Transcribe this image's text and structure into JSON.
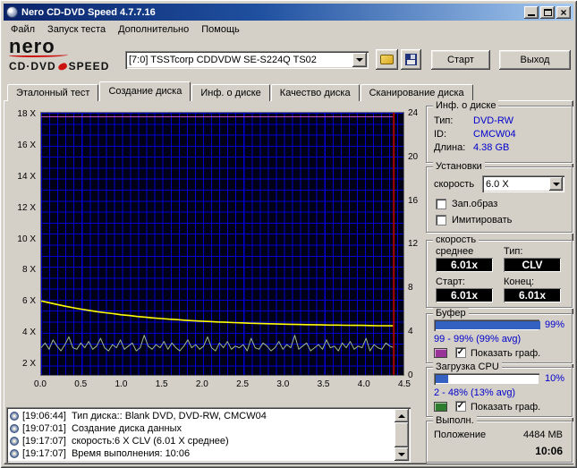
{
  "window": {
    "title": "Nero CD-DVD Speed 4.7.7.16"
  },
  "menu": {
    "items": [
      "Файл",
      "Запуск теста",
      "Дополнительно",
      "Помощь"
    ]
  },
  "logo": {
    "brand": "nero",
    "product_left": "CD·DVD",
    "product_right": "SPEED"
  },
  "toolbar": {
    "drive_selector": "[7:0]   TSSTcorp CDDVDW SE-S224Q TS02",
    "start_button": "Старт",
    "exit_button": "Выход"
  },
  "tabs": [
    {
      "label": "Эталонный тест",
      "active": false
    },
    {
      "label": "Создание диска",
      "active": true
    },
    {
      "label": "Инф. о диске",
      "active": false
    },
    {
      "label": "Качество диска",
      "active": false
    },
    {
      "label": "Сканирование диска",
      "active": false
    }
  ],
  "chart": {
    "type": "line",
    "left_axis_labels": [
      "18 X",
      "16 X",
      "14 X",
      "12 X",
      "10 X",
      "8 X",
      "6 X",
      "4 X",
      "2 X"
    ],
    "right_axis_labels": [
      "24",
      "20",
      "16",
      "12",
      "8",
      "4",
      "0"
    ],
    "x_axis_labels": [
      "0.0",
      "0.5",
      "1.0",
      "1.5",
      "2.0",
      "2.5",
      "3.0",
      "3.5",
      "4.0",
      "4.5"
    ],
    "x_range": [
      0,
      4.5
    ],
    "capacity_line_x": 4.38,
    "grid_color": "#0000d2",
    "background": "#000016",
    "series": [
      {
        "name": "write-speed",
        "color": "#ffff00",
        "width": 1.6,
        "x0": 0,
        "x_end": 4.38,
        "values": [
          6.0,
          5.88,
          5.77,
          5.66,
          5.56,
          5.47,
          5.39,
          5.31,
          5.24,
          5.18,
          5.11,
          5.06,
          5.0,
          4.96,
          4.91,
          4.87,
          4.83,
          4.8,
          4.76,
          4.73,
          4.7,
          4.68,
          4.65,
          4.63,
          4.61,
          4.59,
          4.57,
          4.56,
          4.54,
          4.53,
          4.51,
          4.5,
          4.49,
          4.48,
          4.47,
          4.46,
          4.45,
          4.45,
          4.44,
          4.43,
          4.43,
          4.42,
          4.41,
          4.41,
          4.4
        ]
      },
      {
        "name": "cpu-usage",
        "color": "#9dbb8d",
        "width": 1,
        "x0": 0,
        "x_end": 4.38,
        "values": [
          3.0,
          3.3,
          2.9,
          3.5,
          3.1,
          2.8,
          3.2,
          3.7,
          3.0,
          2.9,
          3.3,
          3.0,
          3.4,
          2.9,
          3.1,
          3.6,
          3.0,
          2.8,
          3.2,
          3.0,
          3.5,
          2.9,
          3.1,
          3.3,
          2.8,
          3.0,
          3.8,
          3.1,
          2.9,
          3.2,
          3.0,
          3.4,
          2.9,
          3.3,
          3.0,
          2.8,
          3.1,
          3.5,
          3.0,
          3.2,
          2.9,
          3.1,
          3.7,
          3.0,
          2.8,
          3.3,
          3.0,
          3.4,
          2.9,
          3.1,
          3.0,
          3.2,
          2.8,
          3.6,
          3.0,
          2.9,
          3.3,
          3.1,
          2.8,
          3.0,
          3.4,
          2.9,
          3.2,
          3.0,
          3.8,
          2.9,
          3.1,
          3.3,
          2.8,
          3.0,
          3.2,
          2.9,
          3.5,
          3.0,
          3.1,
          2.8,
          3.3,
          3.0,
          3.4,
          2.9,
          3.1,
          3.0,
          3.6,
          2.8,
          3.2,
          3.0,
          2.9,
          3.3,
          3.1,
          3.0
        ]
      },
      {
        "name": "buffer-level",
        "color": "#c050c0",
        "width": 1,
        "x0": 0,
        "x_end": 4.38,
        "values": [
          17.8,
          17.8
        ]
      }
    ]
  },
  "panels": {
    "disc_info": {
      "title": "Инф. о диске",
      "rows": [
        {
          "label": "Тип:",
          "value": "DVD-RW"
        },
        {
          "label": "ID:",
          "value": "CMCW04"
        },
        {
          "label": "Длина:",
          "value": "4.38 GB"
        }
      ]
    },
    "settings": {
      "title": "Установки",
      "speed_label": "скорость",
      "speed_value": "6.0 X",
      "checkboxes": [
        {
          "label": "Зап.образ",
          "checked": false
        },
        {
          "label": "Имитировать",
          "checked": false
        }
      ]
    },
    "speed": {
      "title": "скорость",
      "average_label": "среднее",
      "average_value": "6.01x",
      "type_label": "Тип:",
      "type_value": "CLV",
      "start_label": "Старт:",
      "start_value": "6.01x",
      "end_label": "Конец:",
      "end_value": "6.01x"
    },
    "buffer": {
      "title": "Буфер",
      "percent_label": "99%",
      "fill_percent": 99,
      "range_text": "99 - 99% (99% avg)",
      "swatch_color": "#993399",
      "show_graph": {
        "label": "Показать граф.",
        "checked": true
      }
    },
    "cpu": {
      "title": "Загрузка CPU",
      "percent_label": "10%",
      "fill_percent": 12,
      "range_text": "2 - 48% (13% avg)",
      "swatch_color": "#2e7d2e",
      "show_graph": {
        "label": "Показать граф.",
        "checked": true
      }
    },
    "progress": {
      "title": "Выполн.",
      "position_label": "Положение",
      "position_value": "4484 MB",
      "elapsed_value": "10:06"
    }
  },
  "log": {
    "entries": [
      {
        "time": "[19:06:44]",
        "text": "Тип диска:: Blank DVD, DVD-RW, CMCW04"
      },
      {
        "time": "[19:07:01]",
        "text": "Создание диска данных"
      },
      {
        "time": "[19:17:07]",
        "text": "скорость:6 X CLV (6.01 X среднее)"
      },
      {
        "time": "[19:17:07]",
        "text": "Время выполнения: 10:06"
      }
    ]
  },
  "colors": {
    "value_text": "#0000cc",
    "progress_fill": "#3361c2",
    "capacity_line": "#aa0000"
  }
}
